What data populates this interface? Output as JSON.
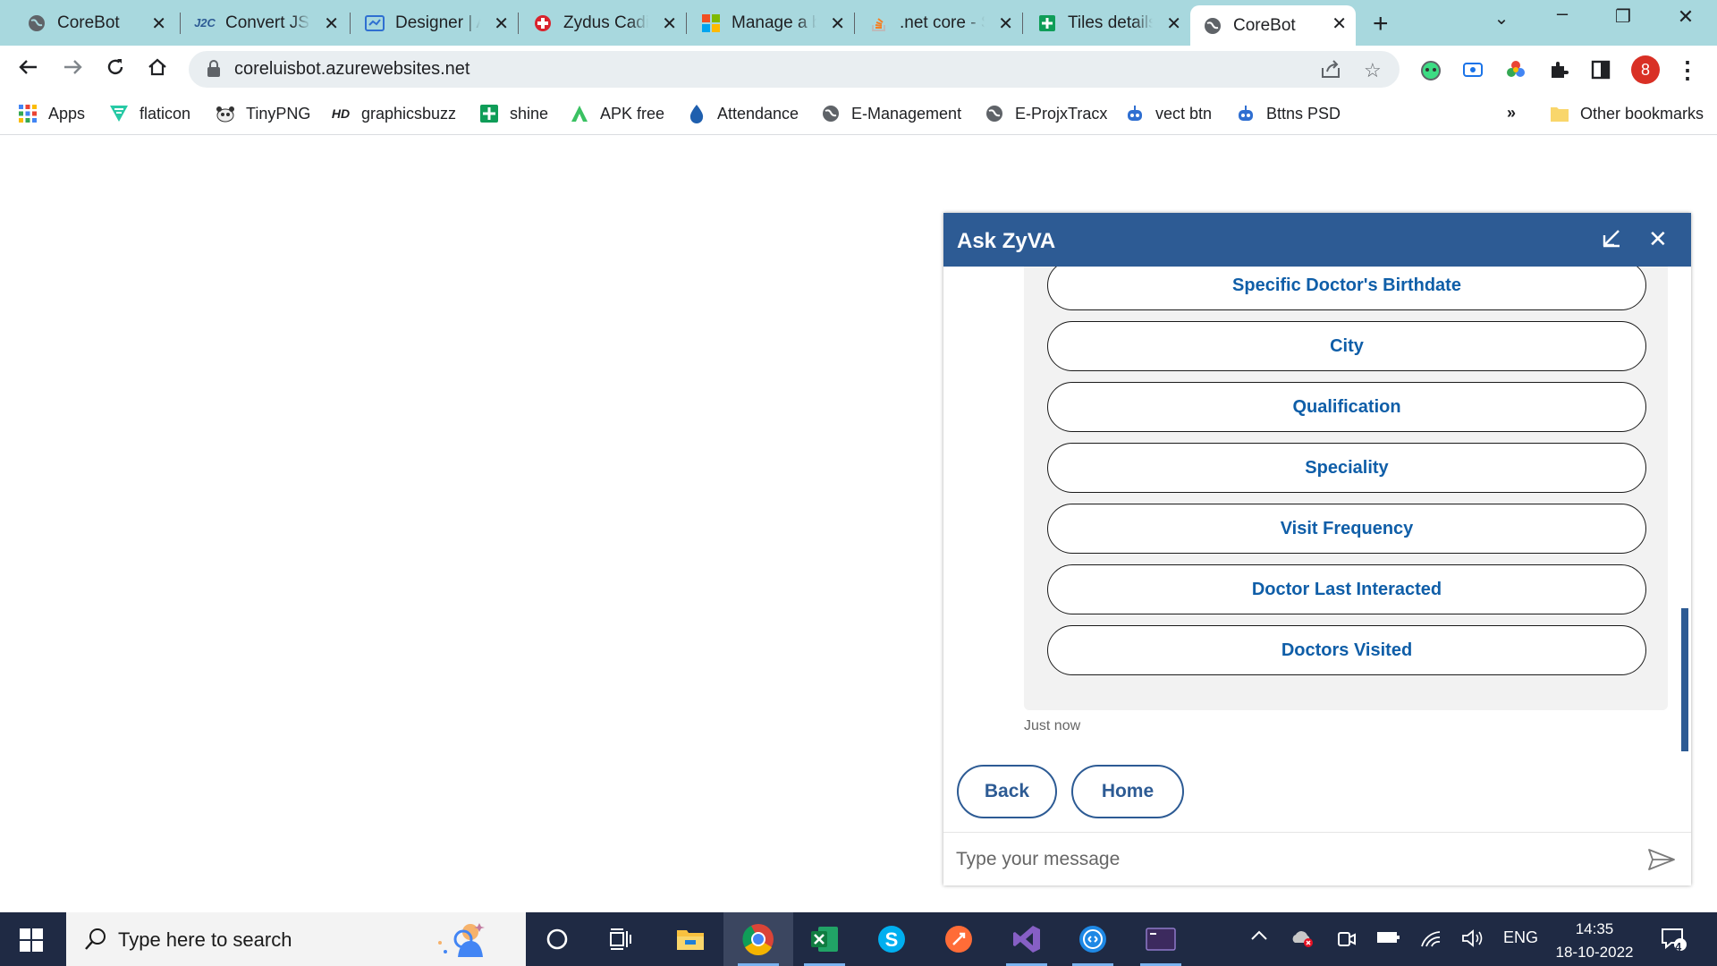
{
  "browser": {
    "tabs": [
      {
        "title": "CoreBot",
        "icon": "globe-icon"
      },
      {
        "title": "Convert JSON",
        "icon": "j2c-icon"
      },
      {
        "title": "Designer | Azure",
        "icon": "designer-icon"
      },
      {
        "title": "Zydus Cadila",
        "icon": "zydus-icon"
      },
      {
        "title": "Manage a bot",
        "icon": "microsoft-icon"
      },
      {
        "title": ".net core - Stack",
        "icon": "stackoverflow-icon"
      },
      {
        "title": "Tiles details",
        "icon": "sheets-icon"
      },
      {
        "title": "CoreBot",
        "icon": "globe-icon"
      }
    ],
    "active_tab_index": 7,
    "url": "coreluisbot.azurewebsites.net",
    "profile_badge": "8",
    "bookmarks": [
      {
        "label": "Apps",
        "icon": "apps-grid-icon"
      },
      {
        "label": "flaticon",
        "icon": "flaticon-icon"
      },
      {
        "label": "TinyPNG",
        "icon": "panda-icon"
      },
      {
        "label": "graphicsbuzz",
        "icon": "hd-icon"
      },
      {
        "label": "shine",
        "icon": "plus-green-icon"
      },
      {
        "label": "APK free",
        "icon": "apk-icon"
      },
      {
        "label": "Attendance",
        "icon": "drop-icon"
      },
      {
        "label": "E-Management",
        "icon": "globe-icon"
      },
      {
        "label": "E-ProjxTracx",
        "icon": "globe-icon"
      },
      {
        "label": "vect btn",
        "icon": "robot-icon"
      },
      {
        "label": "Bttns PSD",
        "icon": "robot-icon"
      }
    ],
    "overflow_label": "»",
    "other_bookmarks": "Other bookmarks"
  },
  "chat": {
    "title": "Ask ZyVA",
    "choices": [
      "Specific Doctor's Birthdate",
      "City",
      "Qualification",
      "Speciality",
      "Visit Frequency",
      "Doctor Last Interacted",
      "Doctors Visited"
    ],
    "timestamp": "Just now",
    "suggestions": [
      "Back",
      "Home"
    ],
    "input_placeholder": "Type your message",
    "accent": "#2d5b94",
    "choice_text_color": "#0f5ea8"
  },
  "taskbar": {
    "search_placeholder": "Type here to search",
    "language": "ENG",
    "time": "14:35",
    "date": "18-10-2022",
    "notification_count": "4"
  }
}
